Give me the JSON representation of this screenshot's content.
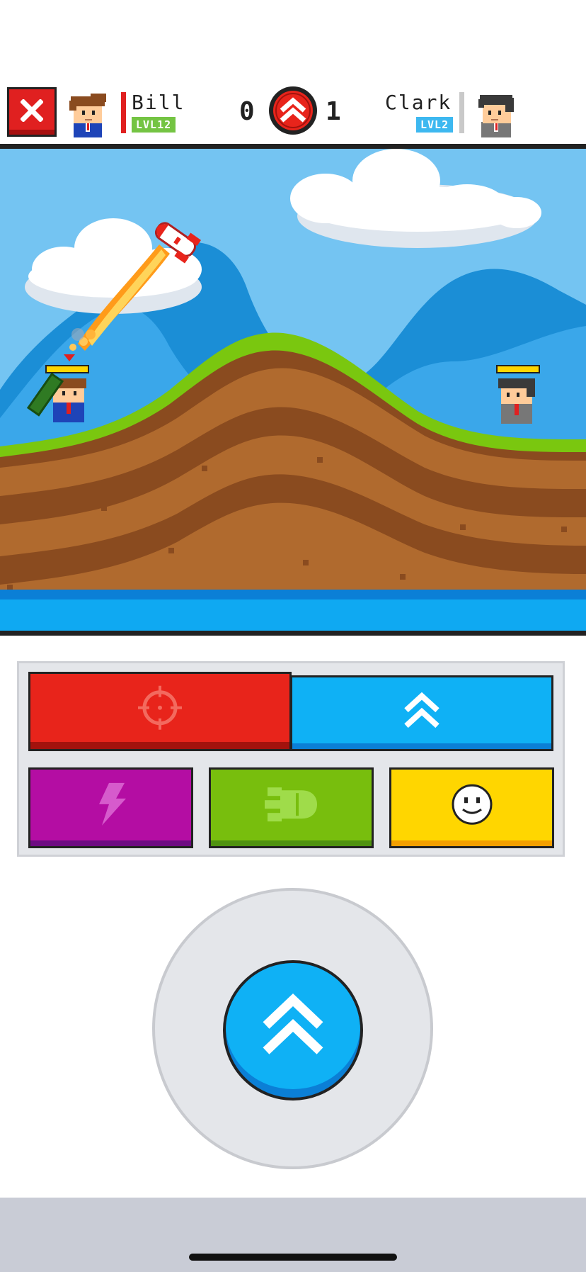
{
  "header": {
    "close_icon": "close-icon",
    "player1": {
      "name": "Bill",
      "level": "LVL12",
      "bar_color": "#e02020"
    },
    "player2": {
      "name": "Clark",
      "level": "LVL2",
      "bar_color": "#c9c9c9"
    },
    "score": {
      "left": "0",
      "right": "1",
      "badge_icon": "double-chevron-up-icon"
    }
  },
  "controls": {
    "aim": {
      "icon": "crosshair-icon",
      "color": "#e8241b"
    },
    "missile": {
      "icon": "double-chevron-up-icon",
      "color": "#0fb1f5"
    },
    "power": {
      "icon": "lightning-icon",
      "color": "#b40da3"
    },
    "bomb": {
      "icon": "bomb-icon",
      "color": "#78be0d"
    },
    "emote": {
      "icon": "smiley-icon",
      "color": "#ffd600"
    }
  },
  "joystick": {
    "fire_icon": "double-chevron-up-icon",
    "fire_color": "#0fb1f5"
  },
  "colors": {
    "sky": "#74c4f2",
    "grass": "#7ac70f",
    "dirt": "#b06a2e",
    "water": "#0fa9f2"
  }
}
